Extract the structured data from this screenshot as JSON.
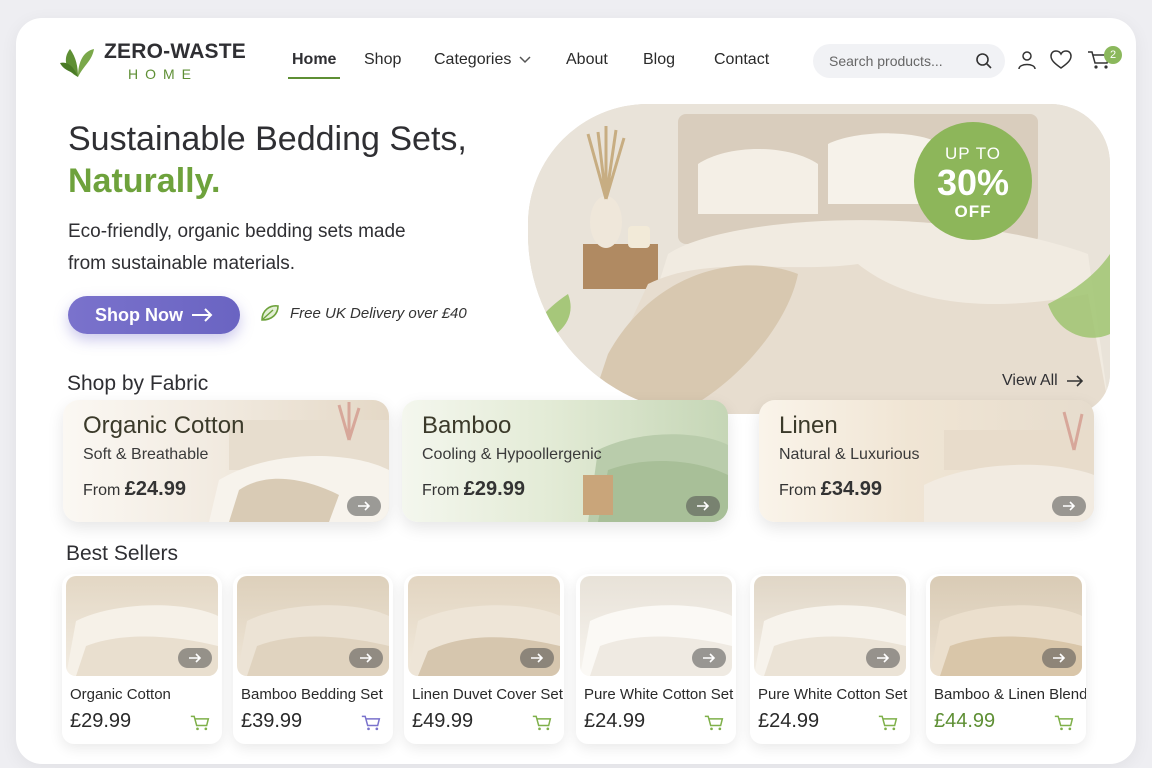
{
  "brand": {
    "name_top": "ZERO-WASTE",
    "name_bottom": "HOME",
    "accent": "#5e8f34"
  },
  "nav": {
    "items": [
      "Home",
      "Shop",
      "Categories",
      "About",
      "Blog",
      "Contact"
    ],
    "active": "Home"
  },
  "search": {
    "placeholder": "Search products..."
  },
  "cart": {
    "count": "2"
  },
  "hero": {
    "title": "Sustainable Bedding Sets,",
    "title_accent": "Naturally.",
    "subtitle": "Eco-friendly, organic bedding sets made from sustainable materials.",
    "cta": "Shop Now",
    "delivery": "Free UK Delivery over £40",
    "promo": {
      "line1": "UP TO",
      "line2": "30%",
      "line3": "OFF"
    }
  },
  "fabric": {
    "title": "Shop by Fabric",
    "view_all": "View All",
    "cards": [
      {
        "name": "Organic Cotton",
        "desc": "Soft & Breathable",
        "from": "From",
        "price": "£24.99"
      },
      {
        "name": "Bamboo",
        "desc": "Cooling & Hypoollergenic",
        "from": "From",
        "price": "£29.99"
      },
      {
        "name": "Linen",
        "desc": "Natural & Luxurious",
        "from": "From",
        "price": "£34.99"
      }
    ]
  },
  "best_sellers": {
    "title": "Best Sellers",
    "products": [
      {
        "name": "Organic Cotton",
        "price": "£29.99"
      },
      {
        "name": "Bamboo Bedding Set",
        "price": "£39.99"
      },
      {
        "name": "Linen Duvet Cover Set",
        "price": "£49.99"
      },
      {
        "name": "Pure White Cotton Set",
        "price": "£24.99"
      },
      {
        "name": "Pure White Cotton Set",
        "price": "£24.99"
      },
      {
        "name": "Bamboo & Linen Blend",
        "price": "£44.99"
      }
    ]
  }
}
